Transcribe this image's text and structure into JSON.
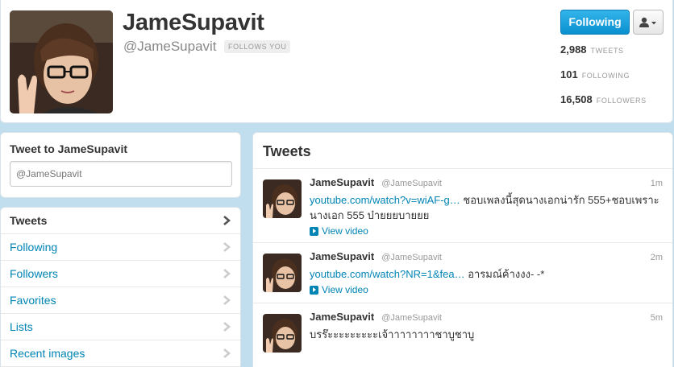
{
  "profile": {
    "name": "JameSupavit",
    "handle": "@JameSupavit",
    "follows_you": "FOLLOWS YOU",
    "following_button": "Following",
    "user_menu_icon": "person-dropdown-icon",
    "stats": [
      {
        "value": "2,988",
        "label": "TWEETS"
      },
      {
        "value": "101",
        "label": "FOLLOWING"
      },
      {
        "value": "16,508",
        "label": "FOLLOWERS"
      }
    ]
  },
  "tweet_to": {
    "title": "Tweet to JameSupavit",
    "placeholder": "@JameSupavit"
  },
  "nav": {
    "items": [
      {
        "label": "Tweets",
        "active": true
      },
      {
        "label": "Following"
      },
      {
        "label": "Followers"
      },
      {
        "label": "Favorites"
      },
      {
        "label": "Lists"
      },
      {
        "label": "Recent images"
      }
    ]
  },
  "stream": {
    "title": "Tweets",
    "tweets": [
      {
        "name": "JameSupavit",
        "handle": "@JameSupavit",
        "time": "1m",
        "link": "youtube.com/watch?v=wiAF-g…",
        "text": " ชอบเพลงนี้สุดนางเอกน่ารัก 555+ชอบเพราะนางเอก 555 บ๋ายยยบายยย",
        "view_video": "View video"
      },
      {
        "name": "JameSupavit",
        "handle": "@JameSupavit",
        "time": "2m",
        "link": "youtube.com/watch?NR=1&fea…",
        "text": " อารมณ์ค้างงง- -*",
        "view_video": "View video"
      },
      {
        "name": "JameSupavit",
        "handle": "@JameSupavit",
        "time": "5m",
        "link": "",
        "text": "บรร๊ะะะะะะะะะเจ้าาาาาาาาชาบูชาบู",
        "view_video": ""
      }
    ]
  },
  "colors": {
    "background": "#c0deed",
    "link": "#0084b4",
    "following_button": "#1da1e0"
  }
}
